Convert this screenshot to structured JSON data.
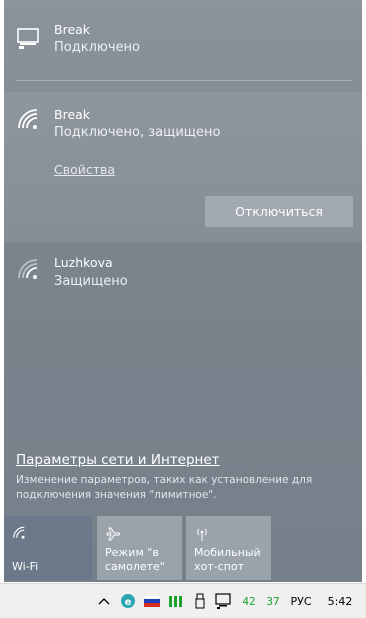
{
  "wired": {
    "name": "Break",
    "status": "Подключено",
    "icon": "ethernet-icon"
  },
  "wifi_active": {
    "name": "Break",
    "status": "Подключено, защищено",
    "properties_link": "Свойства",
    "disconnect_button": "Отключиться",
    "icon": "wifi-icon"
  },
  "wifi_other": {
    "name": "Luzhkova",
    "status": "Защищено",
    "icon": "wifi-icon"
  },
  "settings": {
    "link": "Параметры сети и Интернет",
    "description": "Изменение параметров, таких как установление для подключения значения \"лимитное\"."
  },
  "tiles": [
    {
      "label": "Wi-Fi",
      "icon": "wifi-icon",
      "active": true
    },
    {
      "label": "Режим \"в самолете\"",
      "icon": "airplane-icon",
      "active": false
    },
    {
      "label": "Мобильный хот-спот",
      "icon": "hotspot-icon",
      "active": false
    }
  ],
  "taskbar": {
    "counter_a": "42",
    "counter_b": "37",
    "language": "РУС",
    "time": "5:42"
  },
  "colors": {
    "accent": "#6a7889",
    "panel": "#7b848d",
    "green": "#1aa32a"
  }
}
